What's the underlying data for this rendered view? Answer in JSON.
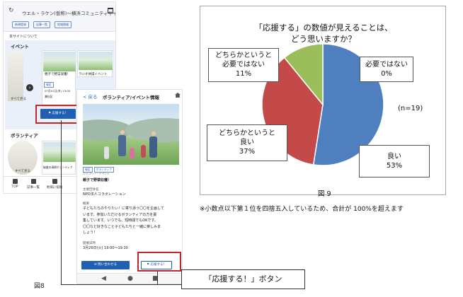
{
  "figure8": {
    "label": "図8",
    "callout": "「応援する！」ボタン",
    "phone1": {
      "title": "ウエル・ラケン(仮称)～横浜コミュニティサイト～",
      "tabs": [
        "新規登録",
        "記事一覧",
        "地域情報"
      ],
      "about": "本サイトについて",
      "section_event": "イベント",
      "card1_label": "親子で野菜収穫！",
      "card2_label": "ラジオ体操イベント",
      "see_all": "すべて見る",
      "card_date": "07月01日(木) 13:00",
      "card_place": "瀬谷区",
      "support_button": "応援する！",
      "section_volunteer": "ボランティア",
      "vol_see_all": "すべて見る",
      "vol_card_label": "緑道の清掃ボランティア",
      "nav": [
        "TOP",
        "記事一覧",
        "地域に投稿"
      ]
    },
    "phone2": {
      "back": "< 戻る",
      "title": "ボランティア/イベント情報",
      "tags": [
        "緑区",
        "ボランティア"
      ],
      "small_meta": "カテゴリー・イベント",
      "heading": "親子で野菜収穫！",
      "organizer_label": "主催団体名",
      "organizer": "NPO法人コラボレーション",
      "overview_label": "概要",
      "overview_lines": [
        "子どもたちのやりたい！に寄り添う〇〇を企画して",
        "います。参加いただけるボランティアの方を募",
        "集しています。いつでも、短時間でもOKです。",
        "〇〇など好きなこと子どもたちと一緒に楽しみま",
        "しょう！"
      ],
      "datetime_label": "開催日時",
      "datetime": "3月26日(火) 19:00～19:30",
      "button_left": "問い合わせる",
      "button_support": "応援する！"
    }
  },
  "chart_data": {
    "type": "pie",
    "title": [
      "「応援する」の数値が見えることは、",
      "どう思いますか？"
    ],
    "slices": [
      {
        "name": "良い",
        "value": 53,
        "label": "53%",
        "color": "#4f7fbf"
      },
      {
        "name": "どちらかというと良い",
        "value": 37,
        "label": "37%",
        "color": "#c44a4a"
      },
      {
        "name": "どちらかというと必要ではない",
        "value": 11,
        "label": "11%",
        "color": "#9cbe5a"
      },
      {
        "name": "必要ではない",
        "value": 0,
        "label": "0%",
        "color": "#7b5fa8"
      }
    ],
    "n_label": "(n=19)",
    "figure_label": "図 9",
    "footnote": "※小数点以下第１位を四捨五入しているため、合計が 100%を超えます"
  }
}
